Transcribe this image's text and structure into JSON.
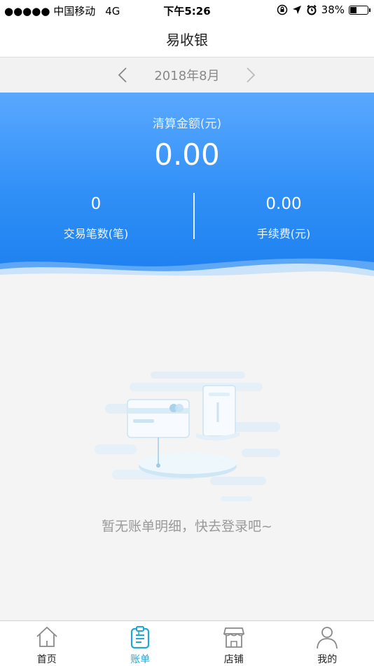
{
  "status_bar": {
    "carrier": "●●●●● 中国移动",
    "network": "4G",
    "time": "下午5:26",
    "battery_percent_text": "38%",
    "battery_level": 0.38
  },
  "nav": {
    "title": "易收银"
  },
  "month_selector": {
    "current": "2018年8月"
  },
  "summary": {
    "settlement_label": "清算金额(元)",
    "settlement_amount": "0.00",
    "transactions_value": "0",
    "transactions_label": "交易笔数(笔)",
    "fees_value": "0.00",
    "fees_label": "手续费(元)"
  },
  "empty_state": {
    "message": "暂无账单明细，快去登录吧~"
  },
  "tabs": [
    {
      "label": "首页",
      "icon": "home-icon",
      "active": false
    },
    {
      "label": "账单",
      "icon": "bill-icon",
      "active": true
    },
    {
      "label": "店铺",
      "icon": "store-icon",
      "active": false
    },
    {
      "label": "我的",
      "icon": "profile-icon",
      "active": false
    }
  ],
  "colors": {
    "accent": "#1ea7d7",
    "summary_top": "#5aa8ff",
    "summary_bottom": "#1c7fee"
  }
}
